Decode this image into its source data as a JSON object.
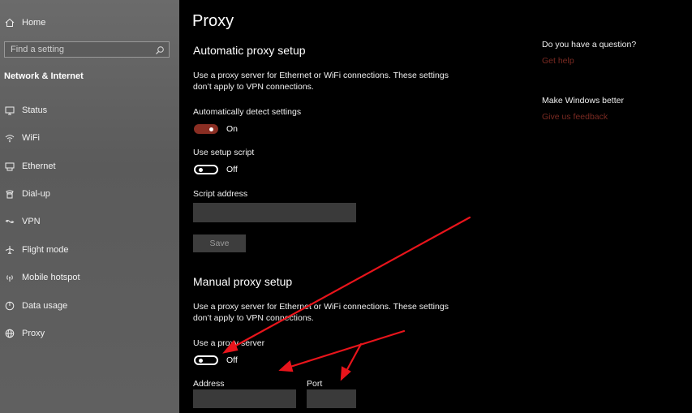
{
  "sidebar": {
    "home_label": "Home",
    "search_placeholder": "Find a setting",
    "section_title": "Network & Internet",
    "items": [
      {
        "label": "Status",
        "icon": "status-icon"
      },
      {
        "label": "WiFi",
        "icon": "wifi-icon"
      },
      {
        "label": "Ethernet",
        "icon": "ethernet-icon"
      },
      {
        "label": "Dial-up",
        "icon": "dialup-icon"
      },
      {
        "label": "VPN",
        "icon": "vpn-icon"
      },
      {
        "label": "Flight mode",
        "icon": "airplane-icon"
      },
      {
        "label": "Mobile hotspot",
        "icon": "hotspot-icon"
      },
      {
        "label": "Data usage",
        "icon": "data-usage-icon"
      },
      {
        "label": "Proxy",
        "icon": "globe-icon"
      }
    ]
  },
  "main": {
    "title": "Proxy",
    "automatic": {
      "heading": "Automatic proxy setup",
      "description": "Use a proxy server for Ethernet or WiFi connections. These settings don’t apply to VPN connections.",
      "detect_label": "Automatically detect settings",
      "detect_state": "On",
      "script_label": "Use setup script",
      "script_state": "Off",
      "address_label": "Script address",
      "address_value": "",
      "save_label": "Save"
    },
    "manual": {
      "heading": "Manual proxy setup",
      "description": "Use a proxy server for Ethernet or WiFi connections. These settings don’t apply to VPN connections.",
      "use_label": "Use a proxy server",
      "use_state": "Off",
      "address_label": "Address",
      "address_value": "",
      "port_label": "Port",
      "port_value": ""
    }
  },
  "aside": {
    "question_heading": "Do you have a question?",
    "help_link": "Get help",
    "better_heading": "Make Windows better",
    "feedback_link": "Give us feedback"
  },
  "colors": {
    "accent": "#8a2e23",
    "annotation_arrow": "#e8141b",
    "sidebar_bg": "#626262"
  }
}
